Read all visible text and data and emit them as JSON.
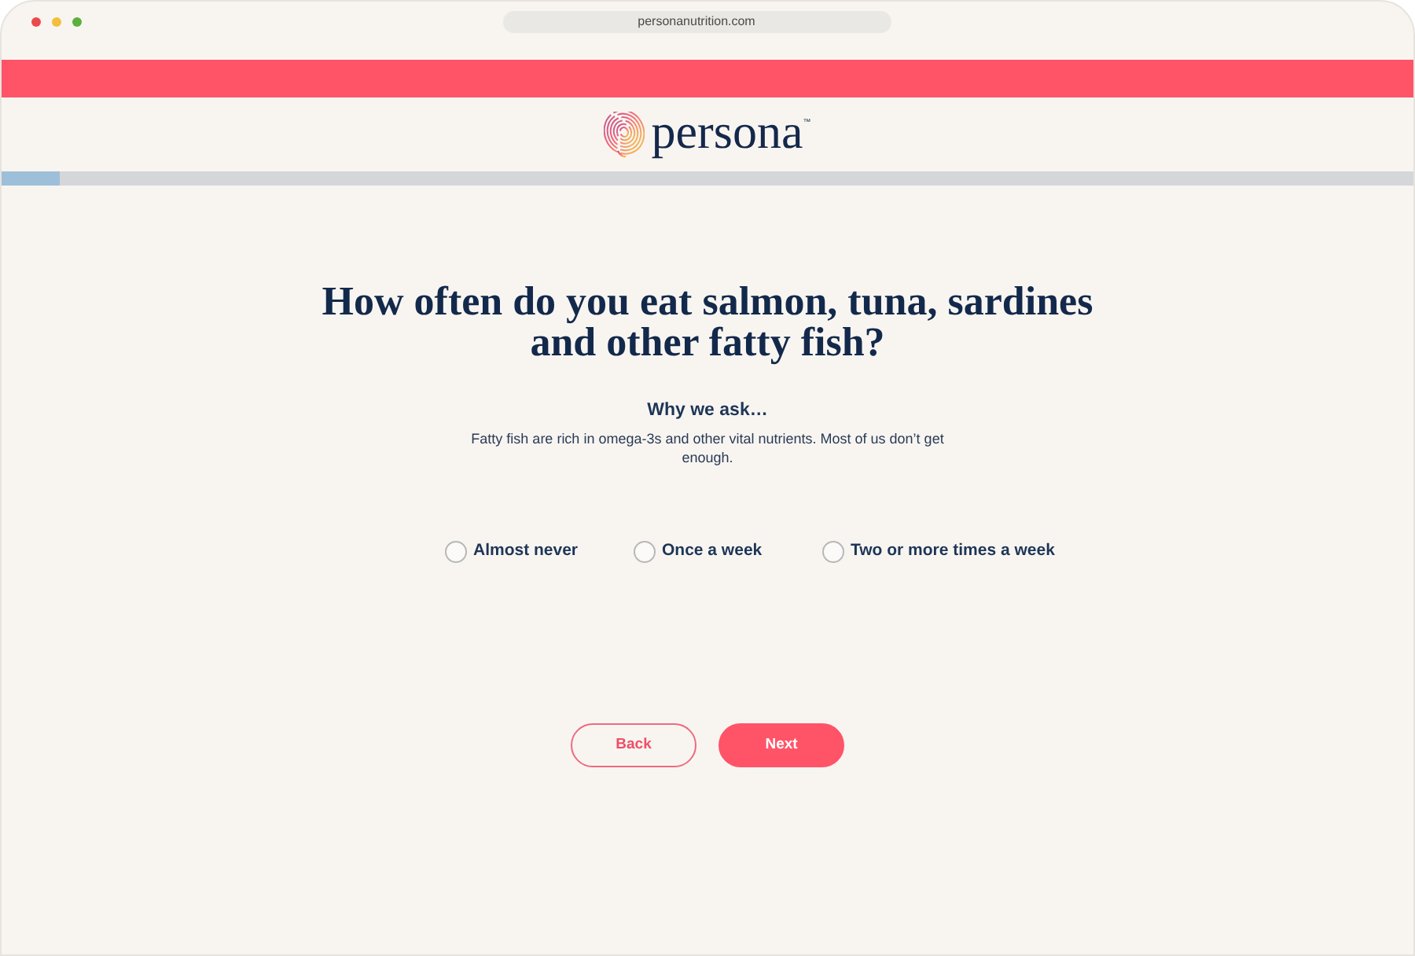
{
  "browser": {
    "url": "personanutrition.com"
  },
  "logo": {
    "wordmark": "persona",
    "trademark": "™"
  },
  "progress": {
    "level": 0.041
  },
  "question": {
    "title": "How often do you eat salmon, tuna, sardines and other fatty fish?",
    "why_heading": "Why we ask…",
    "why_text": "Fatty fish are rich in omega-3s and other vital nutrients. Most of us don’t get enough."
  },
  "options": [
    {
      "label": "Almost never",
      "selected": false
    },
    {
      "label": "Once a week",
      "selected": false
    },
    {
      "label": "Two or more times a week",
      "selected": false
    }
  ],
  "buttons": [
    {
      "label": "Back",
      "kind": "secondary"
    },
    {
      "label": "Next",
      "kind": "primary"
    }
  ]
}
